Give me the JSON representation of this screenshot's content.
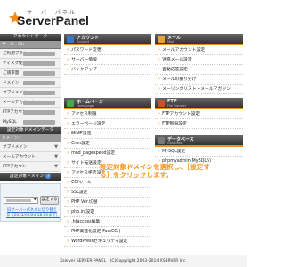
{
  "logo": {
    "kana": "サーバーパネル",
    "name": "ServerPanel"
  },
  "sidebar": {
    "account_header": "アカウントデータ",
    "server_id_label": "サーバーID：",
    "items": [
      {
        "label": "ご利用プラン"
      },
      {
        "label": "ディスク使用量"
      },
      {
        "label": "ご請求量"
      },
      {
        "label": "ドメイン"
      },
      {
        "label": "サブドメイン"
      },
      {
        "label": "メールアカウント"
      },
      {
        "label": "FTPアカウント"
      },
      {
        "label": "MySQL"
      }
    ],
    "domain_data_header": "設定対象ドメインデータ",
    "domain_label": "ドメイン：",
    "domain_items": [
      {
        "label": "サブドメイン"
      },
      {
        "label": "メールアカウント"
      },
      {
        "label": "FTPアカウント"
      }
    ],
    "target_domain_header": "設定対象ドメイン",
    "set_button": "設定する",
    "link_text": "旧サーバーパネルに切り替える（2015/02/24 18:00まで）"
  },
  "panels": {
    "account": {
      "title": "アカウント",
      "sub": "Account",
      "items": [
        "パスワード変更",
        "サーバー情報",
        "バックアップ"
      ]
    },
    "mail": {
      "title": "メール",
      "sub": "Mail",
      "items": [
        "メールアカウント設定",
        "迷惑メール設定",
        "自動応答設定",
        "メールの振り分け",
        "メーリングリスト・メールマガジン"
      ]
    },
    "homepage": {
      "title": "ホームページ",
      "sub": "Homepage",
      "items": [
        "アクセス制限",
        "エラーページ設定",
        "MIME設定",
        "Cron設定",
        "mod_pagespeed設定",
        "サイト転送設定",
        "アクセス拒否設定",
        "CGIツール",
        "SSL設定",
        "PHP Ver.切替",
        "php.ini設定",
        ".htaccess編集",
        "PHP高速化設定(FastCGI)",
        "WordPressセキュリティ設定"
      ]
    },
    "ftp": {
      "title": "FTP",
      "sub": "File Transfer",
      "items": [
        "FTPアカウント設定",
        "FTP制限設定"
      ]
    },
    "database": {
      "title": "データベース",
      "sub": "Database",
      "items": [
        "MySQL設定",
        "phpmyadmin(MySQL5)"
      ]
    }
  },
  "tooltip": "設定対象ドメインを選択し、［設定する］をクリックします。",
  "footer": "Xserver SERVER-PANEL　(C)Copyright 2003-2014 XSERVER Inc.",
  "colors": {
    "accent": "#f28c1c",
    "account_icon": "#3b78c4",
    "mail_icon": "#e8a33c",
    "homepage_icon": "#45a84d",
    "ftp_icon": "#c8502a",
    "database_icon": "#7a7a7a",
    "tooltip": "#f7941d"
  },
  "icons": {
    "logo": "star-icon",
    "help": "help-icon",
    "bullet": "chevron-right-icon"
  }
}
